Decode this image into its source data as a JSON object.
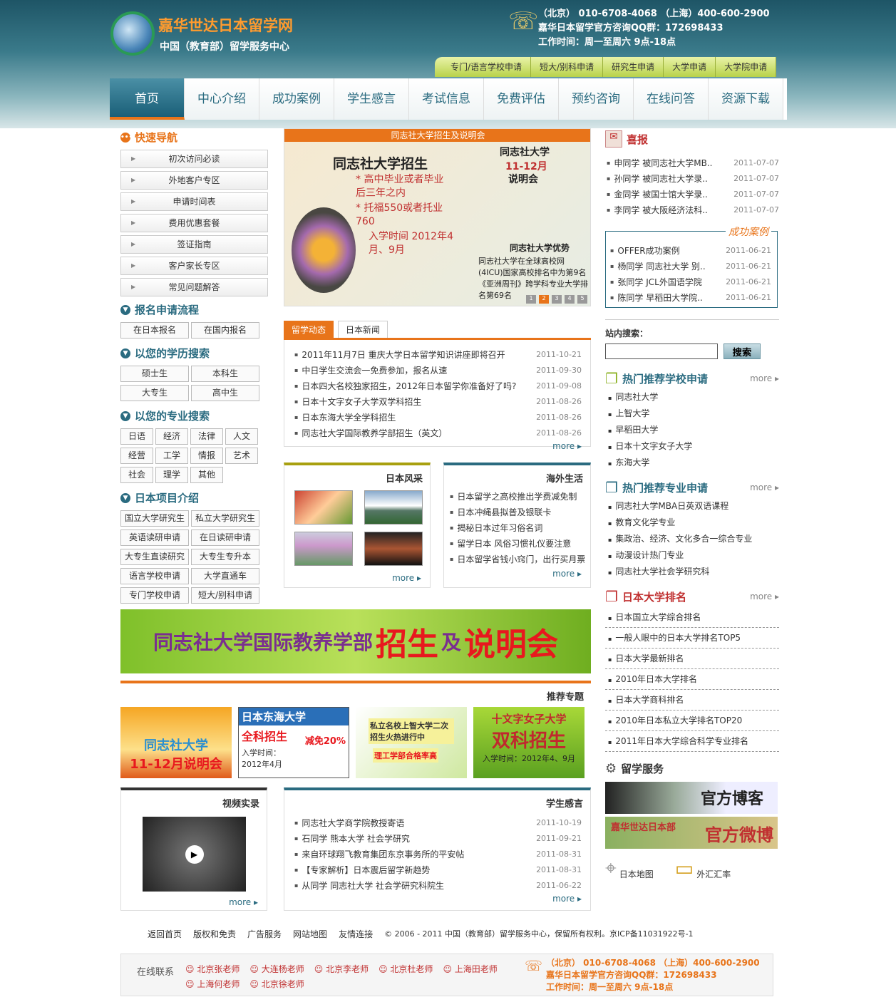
{
  "header": {
    "brand": "嘉华世达日本留学网",
    "subtitle": "中国（教育部）留学服务中心",
    "phone": "（北京） 010-6708-4068 （上海）400-600-2900",
    "qq": "嘉华日本留学官方咨询QQ群：172698433",
    "hours": "工作时间：周一至周六 9点-18点"
  },
  "top_tabs": [
    "专门/语言学校申请",
    "短大/别科申请",
    "研究生申请",
    "大学申请",
    "大学院申请"
  ],
  "nav": [
    "首页",
    "中心介绍",
    "成功案例",
    "学生感言",
    "考试信息",
    "免费评估",
    "预约咨询",
    "在线问答",
    "资源下载"
  ],
  "left": {
    "quick_title": "快速导航",
    "quick": [
      "初次访问必读",
      "外地客户专区",
      "申请时间表",
      "费用优惠套餐",
      "签证指南",
      "客户家长专区",
      "常见问题解答"
    ],
    "apply_title": "报名申请流程",
    "apply": [
      "在日本报名",
      "在国内报名"
    ],
    "edu_title": "以您的学历搜索",
    "edu": [
      "硕士生",
      "本科生",
      "大专生",
      "高中生"
    ],
    "major_title": "以您的专业搜索",
    "major": [
      "日语",
      "经济",
      "法律",
      "人文",
      "经营",
      "工学",
      "情报",
      "艺术",
      "社会",
      "理学",
      "其他"
    ],
    "proj_title": "日本项目介绍",
    "proj": [
      "国立大学研究生",
      "私立大学研究生",
      "英语读研申请",
      "在日读研申请",
      "大专生直读研究",
      "大专生专升本",
      "语言学校申请",
      "大学直通车",
      "专门学校申请",
      "短大/别科申请"
    ]
  },
  "banner": {
    "caption": "同志社大学招生及说明会",
    "title": "同志社大学招生",
    "l1": "* 高中毕业或者毕业后三年之内",
    "l2": "* 托福550或者托业760",
    "l3": "入学时间 2012年4月、9月",
    "r1": "同志社大学",
    "r2": "11-12月",
    "r3": "说明会",
    "r4": "同志社大学优势",
    "r5": "同志社大学在全球高校网(4ICU)国家高校排名中为第9名《亚洲周刊》跨学科专业大学排名第69名",
    "pages": [
      "1",
      "2",
      "3",
      "4",
      "5"
    ]
  },
  "news": {
    "tabs": [
      "留学动态",
      "日本新闻"
    ],
    "items": [
      {
        "t": "2011年11月7日 重庆大学日本留学知识讲座即将召开",
        "d": "2011-10-21"
      },
      {
        "t": "中日学生交流会一免费参加，报名从速",
        "d": "2011-09-30"
      },
      {
        "t": "日本四大名校独家招生，2012年日本留学你准备好了吗?",
        "d": "2011-09-08"
      },
      {
        "t": "日本十文字女子大学双学科招生",
        "d": "2011-08-26"
      },
      {
        "t": "日本东海大学全学科招生",
        "d": "2011-08-26"
      },
      {
        "t": "同志社大学国际教养学部招生（英文）",
        "d": "2011-08-26"
      }
    ],
    "more": "more ▸"
  },
  "fengcai": {
    "title": "日本风采",
    "more": "more ▸"
  },
  "haiwai": {
    "title": "海外生活",
    "items": [
      "日本留学之高校推出学费减免制",
      "日本冲绳县拟普及银联卡",
      "揭秘日本过年习俗名词",
      "留学日本 风俗习惯礼仪要注意",
      "日本留学省钱小窍门，出行买月票"
    ],
    "more": "more ▸"
  },
  "wide_banner": {
    "a": "同志社大学国际教养学部",
    "b": "招生",
    "c": "及",
    "d": "说明会"
  },
  "tuijian": {
    "title": "推荐专题",
    "p1": "同志社大学",
    "p1b": "11-12月说明会",
    "p2": "日本东海大学",
    "p2b": "全科招生",
    "p2c": "减免20%",
    "p2d": "入学时间：2012年4月",
    "p3": "私立名校上智大学二次招生火热进行中",
    "p3b": "理工学部合格率高",
    "p4": "十文字女子大学",
    "p4b": "双科招生",
    "p4c": "入学时间：2012年4、9月"
  },
  "video": {
    "title": "视频实录",
    "more": "more ▸"
  },
  "ganyan": {
    "title": "学生感言",
    "items": [
      {
        "t": "同志社大学商学院教授寄语",
        "d": "2011-10-19"
      },
      {
        "t": "石同学 熊本大学 社会学研究",
        "d": "2011-09-21"
      },
      {
        "t": "来自环球翔飞教育集团东京事务所的平安帖",
        "d": "2011-08-31"
      },
      {
        "t": "【专家解析】日本震后留学新趋势",
        "d": "2011-08-31"
      },
      {
        "t": "从同学 同志社大学 社会学研究科院生",
        "d": "2011-06-22"
      }
    ],
    "more": "more ▸"
  },
  "right": {
    "xibao": "喜报",
    "xibao_items": [
      {
        "t": "申同学 被同志社大学MB..",
        "d": "2011-07-07"
      },
      {
        "t": "孙同学 被同志社大学录..",
        "d": "2011-07-07"
      },
      {
        "t": "金同学 被国士馆大学录..",
        "d": "2011-07-07"
      },
      {
        "t": "李同学 被大阪经济法科..",
        "d": "2011-07-07"
      }
    ],
    "case_title": "成功案例",
    "case_items": [
      {
        "t": "OFFER成功案例",
        "d": "2011-06-21"
      },
      {
        "t": "杨同学 同志社大学 别..",
        "d": "2011-06-21"
      },
      {
        "t": "张同学 JCL外国语学院",
        "d": "2011-06-21"
      },
      {
        "t": "陈同学 早稻田大学院..",
        "d": "2011-06-21"
      }
    ],
    "search_label": "站内搜索：",
    "search_btn": "搜索",
    "hot_school": "热门推荐学校申请",
    "schools": [
      "同志社大学",
      "上智大学",
      "早稻田大学",
      "日本十文字女子大学",
      "东海大学"
    ],
    "hot_major": "热门推荐专业申请",
    "majors": [
      "同志社大学MBA日英双语课程",
      "教育文化学专业",
      "集政治、经济、文化多合一综合专业",
      "动漫设计热门专业",
      "同志社大学社会学研究科"
    ],
    "rank_title": "日本大学排名",
    "ranks": [
      "日本国立大学综合排名",
      "一般人眼中的日本大学排名TOP5",
      "日本大学最新排名",
      "2010年日本大学排名",
      "日本大学商科排名",
      "2010年日本私立大学排名TOP20",
      "2011年日本大学综合科学专业排名"
    ],
    "service": "留学服务",
    "blog": "官方博客",
    "weibo_a": "嘉华世达日本部",
    "weibo_b": "官方微博",
    "map": "日本地图",
    "fx": "外汇汇率",
    "more": "more ▸"
  },
  "footer": {
    "links": [
      "返回首页",
      "版权和免责",
      "广告服务",
      "网站地图",
      "友情连接"
    ],
    "copy": "© 2006 - 2011 中国（教育部）留学服务中心，保留所有权利。京ICP备11031922号-1"
  },
  "online": {
    "label": "在线联系",
    "people": [
      "北京张老师",
      "大连杨老师",
      "北京李老师",
      "北京杜老师",
      "上海田老师",
      "上海何老师",
      "北京徐老师"
    ]
  },
  "colors": {
    "accent": "#e8741a",
    "teal": "#2a6b80",
    "green": "#8ab020"
  }
}
